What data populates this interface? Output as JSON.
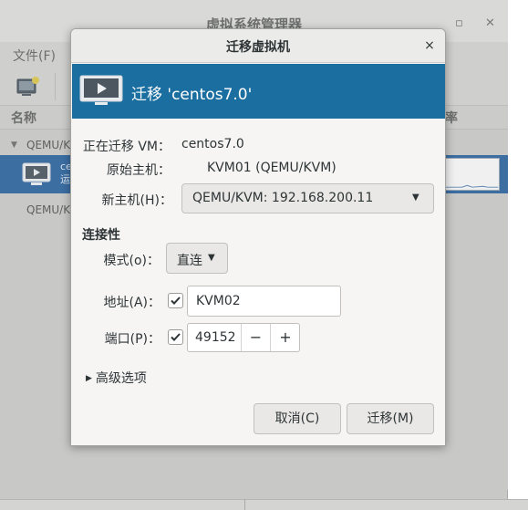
{
  "background": {
    "window_title": "虚拟系统管理器",
    "minimize_glyph": "_",
    "maximize_glyph": "▫",
    "close_glyph": "✕",
    "menu_file": "文件(F)",
    "column_name": "名称",
    "column_rate": "率",
    "rows": [
      {
        "label": "QEMU/KV"
      },
      {
        "label": "QEMU/KV"
      }
    ],
    "selected_vm_line1": "ce",
    "selected_vm_line2": "运"
  },
  "dialog": {
    "title": "迁移虚拟机",
    "close_glyph": "×",
    "banner_text": "迁移 'centos7.0'",
    "migrating_vm_label": "正在迁移 VM：",
    "migrating_vm_value": "centos7.0",
    "source_host_label": "原始主机：",
    "source_host_value": "KVM01 (QEMU/KVM)",
    "new_host_label": "新主机(H)：",
    "new_host_value": "QEMU/KVM: 192.168.200.11",
    "connectivity_heading": "连接性",
    "mode_label": "模式(o)：",
    "mode_value": "直连",
    "address_label": "地址(A)：",
    "address_checked": true,
    "address_value": "KVM02",
    "port_label": "端口(P)：",
    "port_checked": true,
    "port_value": "49152",
    "port_minus": "−",
    "port_plus": "+",
    "advanced_label": "高级选项",
    "cancel_button": "取消(C)",
    "migrate_button": "迁移(M)"
  },
  "colors": {
    "banner": "#1b6ea0",
    "selection": "#3c6ea2"
  }
}
